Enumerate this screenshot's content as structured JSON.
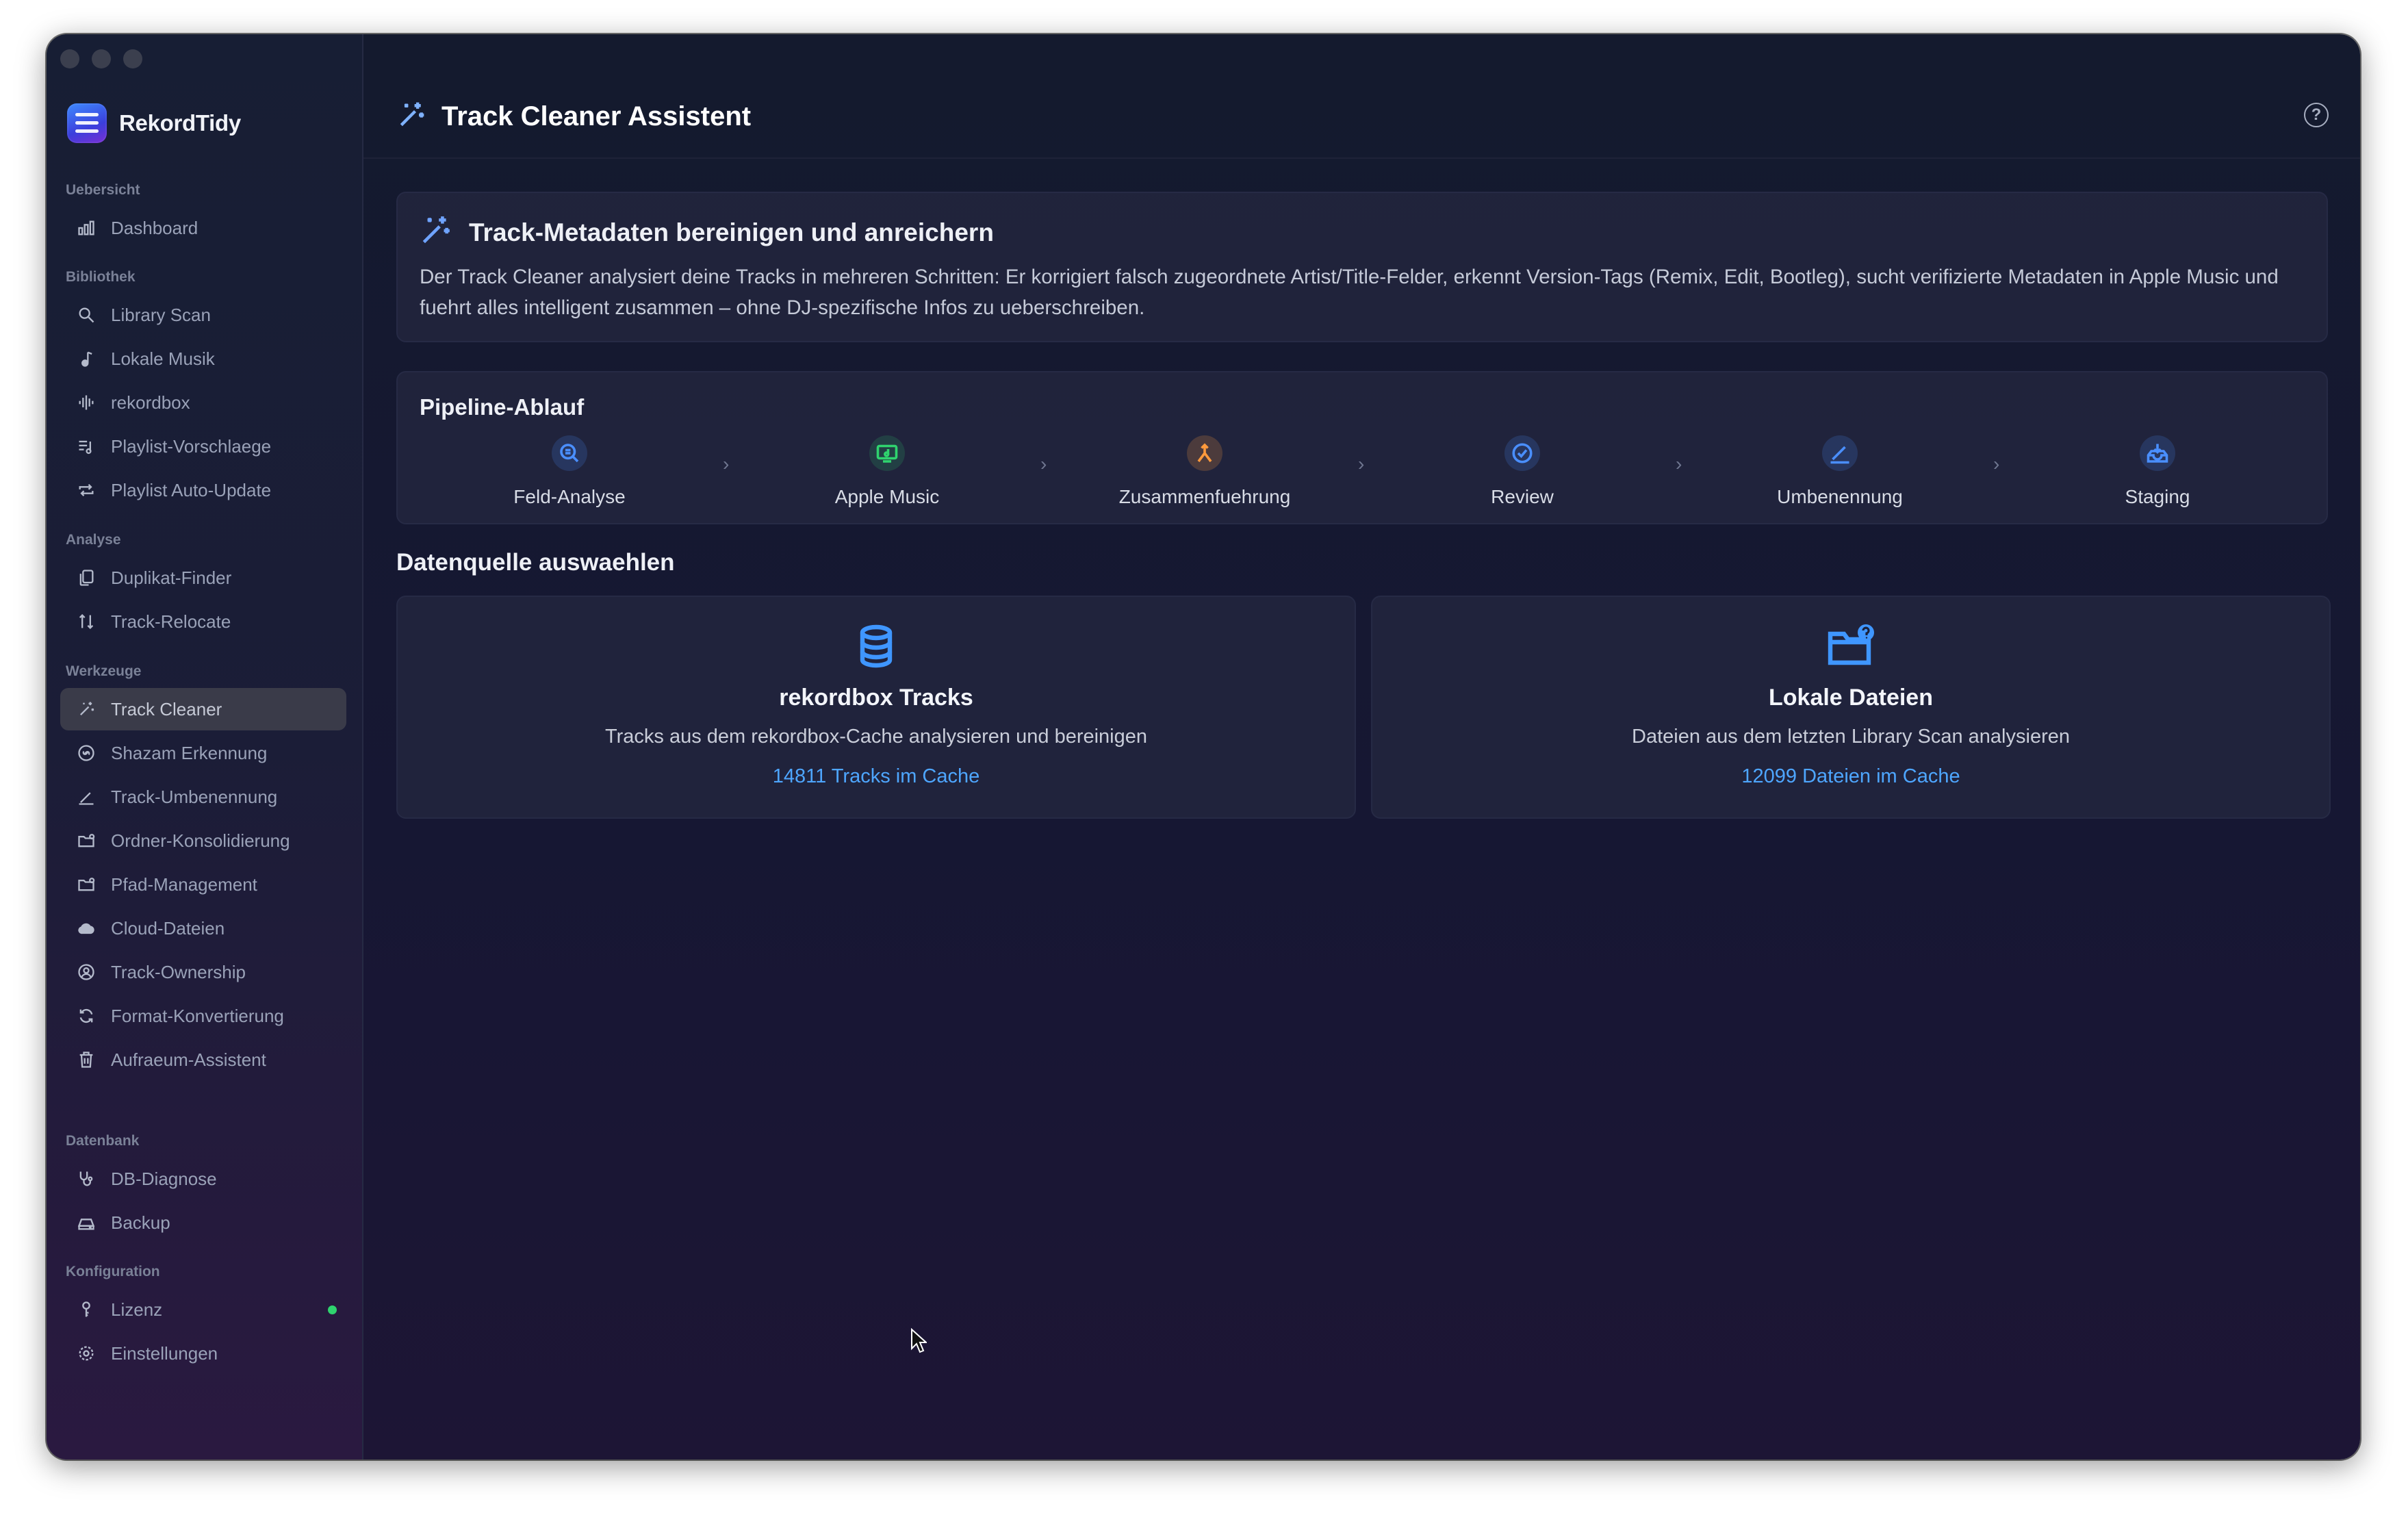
{
  "app": {
    "name": "RekordTidy"
  },
  "sidebar": {
    "sections": [
      {
        "label": "Uebersicht",
        "items": [
          {
            "label": "Dashboard",
            "icon": "bar-chart-icon"
          }
        ]
      },
      {
        "label": "Bibliothek",
        "items": [
          {
            "label": "Library Scan",
            "icon": "search-icon"
          },
          {
            "label": "Lokale Musik",
            "icon": "music-note-icon"
          },
          {
            "label": "rekordbox",
            "icon": "waveform-icon"
          },
          {
            "label": "Playlist-Vorschlaege",
            "icon": "playlist-add-icon"
          },
          {
            "label": "Playlist Auto-Update",
            "icon": "repeat-icon"
          }
        ]
      },
      {
        "label": "Analyse",
        "items": [
          {
            "label": "Duplikat-Finder",
            "icon": "duplicate-icon"
          },
          {
            "label": "Track-Relocate",
            "icon": "relocate-icon"
          }
        ]
      },
      {
        "label": "Werkzeuge",
        "items": [
          {
            "label": "Track Cleaner",
            "icon": "magic-wand-icon",
            "active": true
          },
          {
            "label": "Shazam Erkennung",
            "icon": "shazam-icon"
          },
          {
            "label": "Track-Umbenennung",
            "icon": "pencil-icon"
          },
          {
            "label": "Ordner-Konsolidierung",
            "icon": "folder-icon"
          },
          {
            "label": "Pfad-Management",
            "icon": "folder-icon"
          },
          {
            "label": "Cloud-Dateien",
            "icon": "cloud-icon"
          },
          {
            "label": "Track-Ownership",
            "icon": "ownership-icon"
          },
          {
            "label": "Format-Konvertierung",
            "icon": "convert-icon"
          },
          {
            "label": "Aufraeum-Assistent",
            "icon": "trash-icon"
          }
        ]
      },
      {
        "label": "Datenbank",
        "items": [
          {
            "label": "DB-Diagnose",
            "icon": "stethoscope-icon"
          },
          {
            "label": "Backup",
            "icon": "backup-drive-icon"
          }
        ]
      },
      {
        "label": "Konfiguration",
        "items": [
          {
            "label": "Lizenz",
            "icon": "key-icon",
            "status_dot_color": "#2fd36e"
          },
          {
            "label": "Einstellungen",
            "icon": "gear-icon"
          }
        ]
      }
    ]
  },
  "header": {
    "title": "Track Cleaner Assistent",
    "title_icon": "magic-wand-icon",
    "help_icon": "help-circle-icon",
    "help_glyph": "?"
  },
  "info": {
    "title": "Track-Metadaten bereinigen und anreichern",
    "text": "Der Track Cleaner analysiert deine Tracks in mehreren Schritten: Er korrigiert falsch zugeordnete Artist/Title-Felder, erkennt Version-Tags (Remix, Edit, Bootleg), sucht verifizierte Metadaten in Apple Music und fuehrt alles intelligent zusammen – ohne DJ-spezifische Infos zu ueberschreiben."
  },
  "pipeline": {
    "title": "Pipeline-Ablauf",
    "separator": "›",
    "steps": [
      {
        "label": "Feld-Analyse",
        "icon": "magnifier-icon",
        "color": "#4a8fff"
      },
      {
        "label": "Apple Music",
        "icon": "apple-music-icon",
        "color": "#2fd36e"
      },
      {
        "label": "Zusammenfuehrung",
        "icon": "merge-icon",
        "color": "#ff9a3c"
      },
      {
        "label": "Review",
        "icon": "checkmark-circle-icon",
        "color": "#4a8fff"
      },
      {
        "label": "Umbenennung",
        "icon": "pencil-icon",
        "color": "#4a8fff"
      },
      {
        "label": "Staging",
        "icon": "tray-download-icon",
        "color": "#4a8fff"
      }
    ]
  },
  "datasource": {
    "title": "Datenquelle auswaehlen",
    "options": [
      {
        "title": "rekordbox Tracks",
        "desc": "Tracks aus dem rekordbox-Cache analysieren und bereinigen",
        "count": "14811 Tracks im Cache",
        "icon": "database-icon"
      },
      {
        "title": "Lokale Dateien",
        "desc": "Dateien aus dem letzten Library Scan analysieren",
        "count": "12099 Dateien im Cache",
        "icon": "folder-question-icon"
      }
    ]
  }
}
